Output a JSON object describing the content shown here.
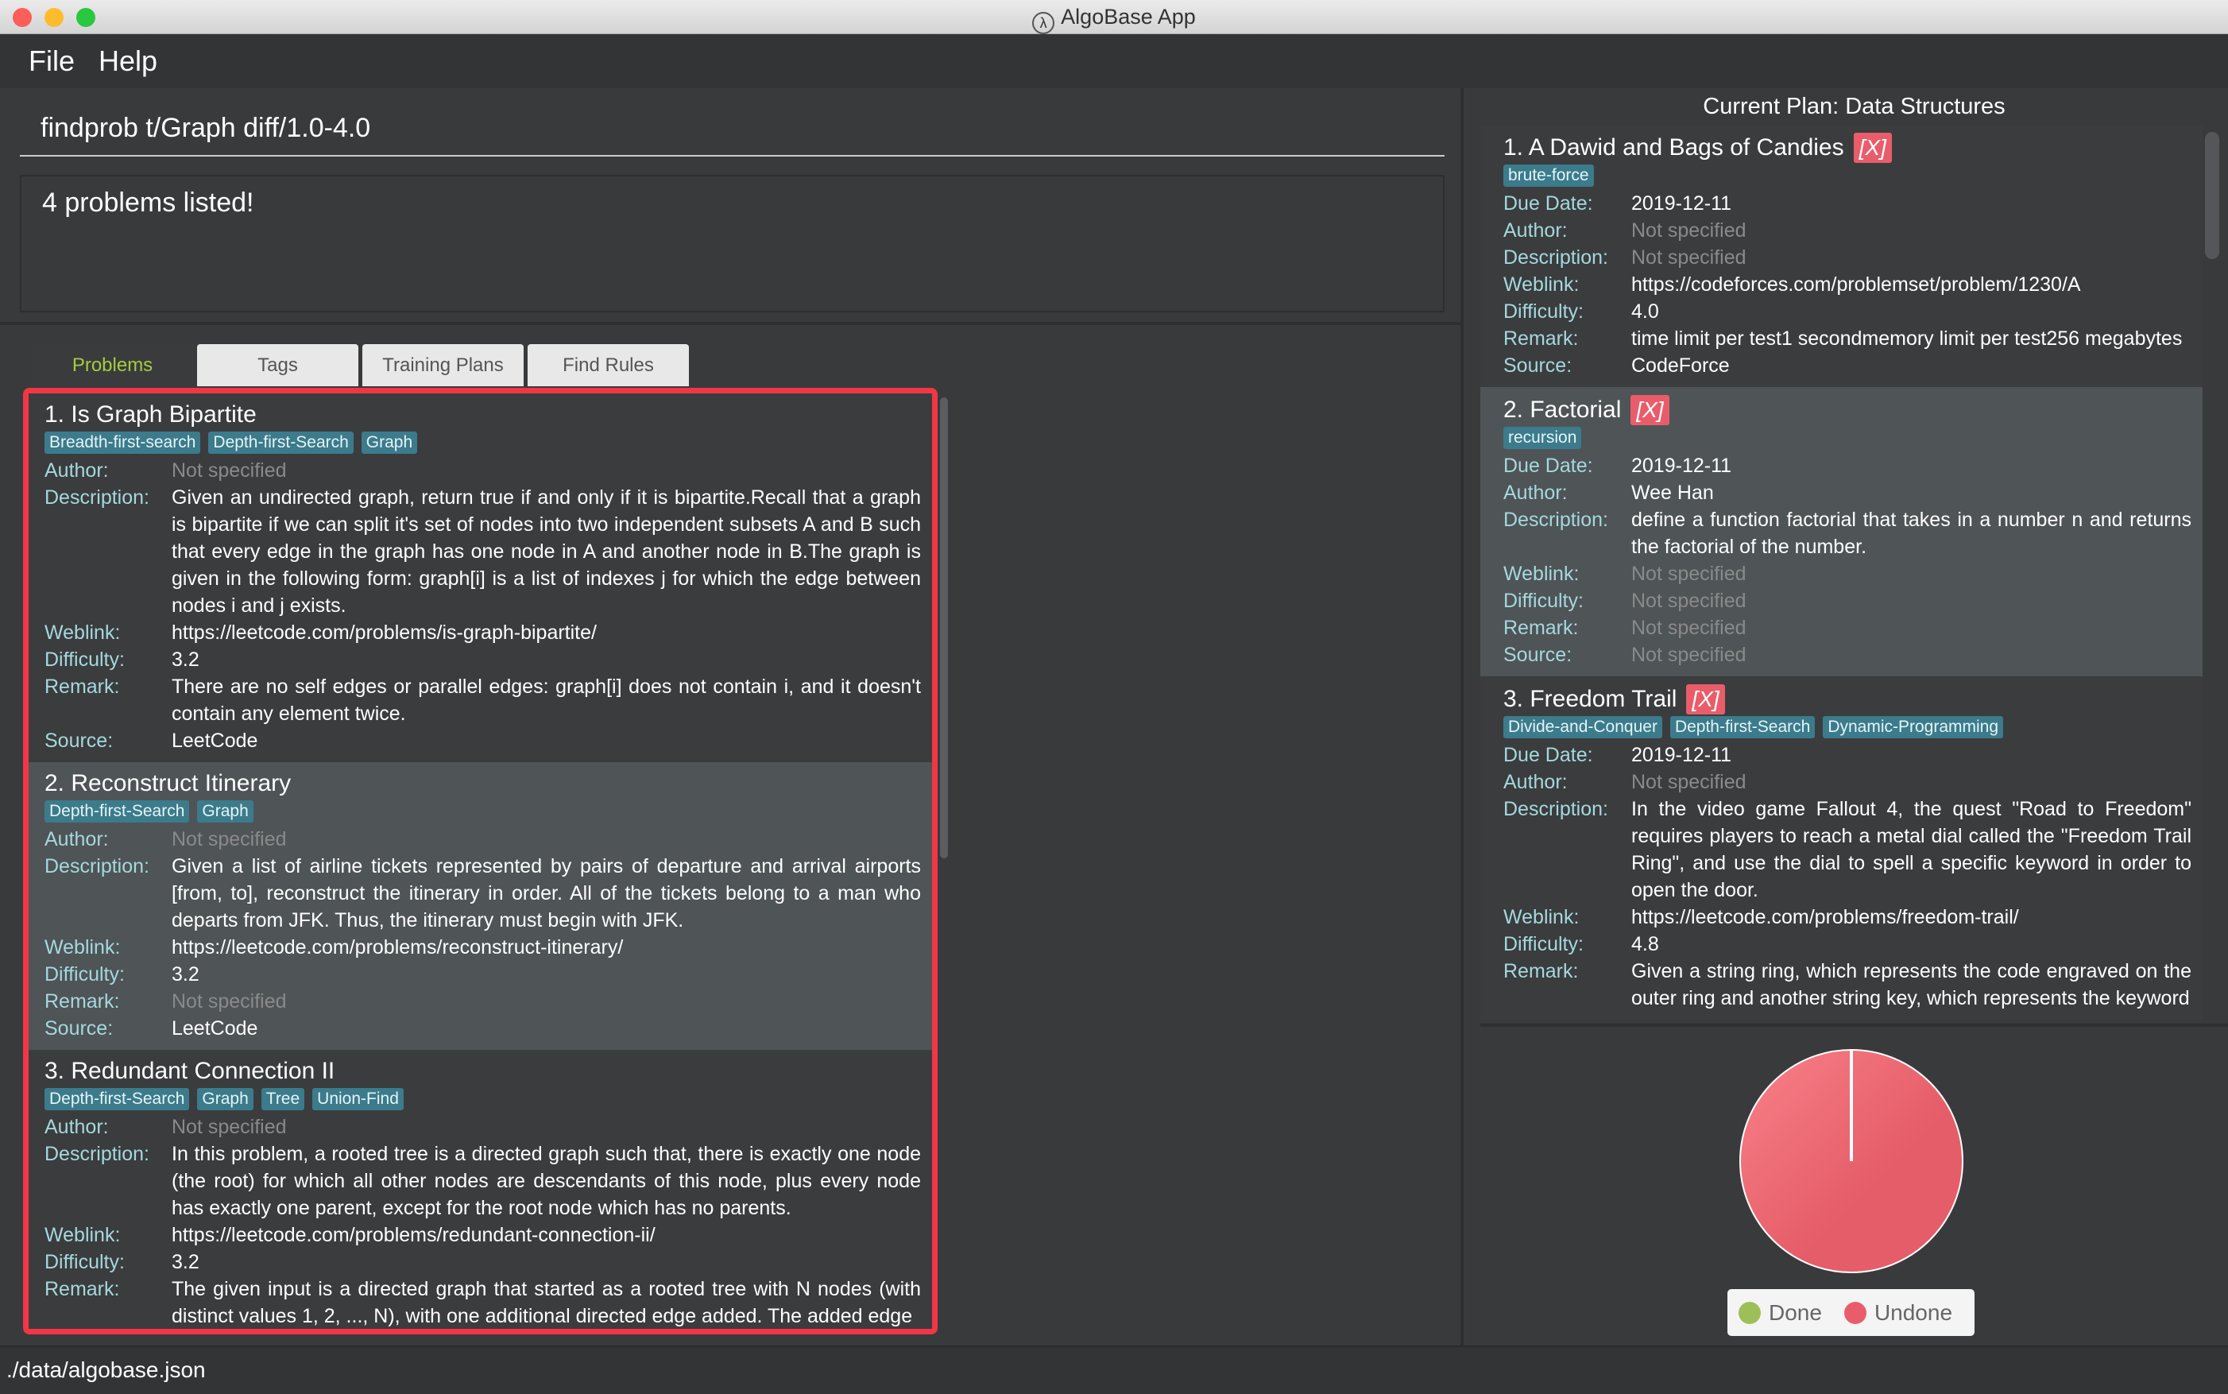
{
  "window": {
    "title": "AlgoBase App"
  },
  "menu": {
    "file": "File",
    "help": "Help"
  },
  "command": {
    "value": "findprob t/Graph diff/1.0-4.0"
  },
  "result": {
    "text": "4 problems listed!"
  },
  "tabs": [
    {
      "label": "Problems",
      "active": true
    },
    {
      "label": "Tags"
    },
    {
      "label": "Training Plans"
    },
    {
      "label": "Find Rules"
    }
  ],
  "labels": {
    "due": "Due Date:",
    "author": "Author:",
    "description": "Description:",
    "weblink": "Weblink:",
    "difficulty": "Difficulty:",
    "remark": "Remark:",
    "source": "Source:",
    "delete": "[X]"
  },
  "problems": [
    {
      "title": "1.  Is Graph Bipartite",
      "tags": [
        "Breadth-first-search",
        "Depth-first-Search",
        "Graph"
      ],
      "author": "Not specified",
      "description": "Given an undirected graph, return true if and only if it is bipartite.Recall that a graph is bipartite if we can split it's set of nodes into two independent subsets A and B such that every edge in the graph has one node in A and another node in B.The graph is given in the following form: graph[i] is a list of indexes j for which the edge between nodes i and j exists.",
      "weblink": "https://leetcode.com/problems/is-graph-bipartite/",
      "difficulty": "3.2",
      "remark": "There are no self edges or parallel edges: graph[i] does not contain i, and it doesn't contain any element twice.",
      "source": "LeetCode"
    },
    {
      "title": "2.  Reconstruct Itinerary",
      "tags": [
        "Depth-first-Search",
        "Graph"
      ],
      "author": "Not specified",
      "description": "Given a list of airline tickets represented by pairs of departure and arrival airports [from, to], reconstruct the itinerary in order. All of the tickets belong to a man who departs from JFK. Thus, the itinerary must begin with JFK.",
      "weblink": "https://leetcode.com/problems/reconstruct-itinerary/",
      "difficulty": "3.2",
      "remark": "Not specified",
      "source": "LeetCode"
    },
    {
      "title": "3.  Redundant Connection II",
      "tags": [
        "Depth-first-Search",
        "Graph",
        "Tree",
        "Union-Find"
      ],
      "author": "Not specified",
      "description": "In this problem, a rooted tree is a directed graph such that, there is exactly one node (the root) for which all other nodes are descendants of this node, plus every node has exactly one parent, except for the root node which has no parents.",
      "weblink": "https://leetcode.com/problems/redundant-connection-ii/",
      "difficulty": "3.2",
      "remark": "The given input is a directed graph that started as a rooted tree with N nodes (with distinct values 1, 2, ..., N), with one additional directed edge added. The added edge"
    }
  ],
  "plan": {
    "header": "Current Plan: Data Structures",
    "items": [
      {
        "title": "1.  A Dawid and Bags of Candies",
        "tags": [
          "brute-force"
        ],
        "due": "2019-12-11",
        "author": "Not specified",
        "description": "Not specified",
        "weblink": "https://codeforces.com/problemset/problem/1230/A",
        "difficulty": "4.0",
        "remark": "time limit per test1 secondmemory limit per test256 megabytes",
        "source": "CodeForce"
      },
      {
        "title": "2.  Factorial",
        "tags": [
          "recursion"
        ],
        "due": "2019-12-11",
        "author": "Wee Han",
        "description": "define a function factorial that takes in a number n and returns the factorial of the number.",
        "weblink": "Not specified",
        "difficulty": "Not specified",
        "remark": "Not specified",
        "source": "Not specified"
      },
      {
        "title": "3.  Freedom Trail",
        "tags": [
          "Divide-and-Conquer",
          "Depth-first-Search",
          "Dynamic-Programming"
        ],
        "due": "2019-12-11",
        "author": "Not specified",
        "description": "In the video game Fallout 4, the quest \"Road to Freedom\" requires players to reach a metal dial called the \"Freedom Trail Ring\", and use the dial to spell a specific keyword in order to open the door.",
        "weblink": "https://leetcode.com/problems/freedom-trail/",
        "difficulty": "4.8",
        "remark": "Given a string ring, which represents the code engraved on the outer ring and another string key, which represents the keyword"
      }
    ]
  },
  "chart_data": {
    "type": "pie",
    "categories": [
      "Done",
      "Undone"
    ],
    "values": [
      0,
      3
    ],
    "colors": [
      "#9dbf57",
      "#e95d6b"
    ],
    "legend": "bottom"
  },
  "status": {
    "path": "./data/algobase.json"
  }
}
